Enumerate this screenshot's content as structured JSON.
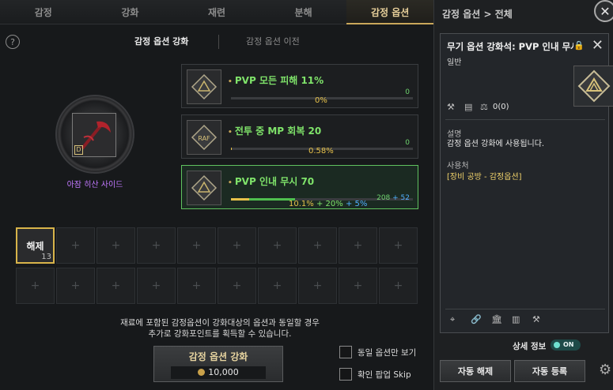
{
  "tabs": [
    "감정",
    "강화",
    "재련",
    "분해",
    "감정 옵션"
  ],
  "active_tab_index": 4,
  "help_label": "?",
  "subtabs": {
    "enhance": "감정 옵션 강화",
    "transfer": "감정 옵션 이전"
  },
  "item": {
    "name": "아잠 히산 사이드",
    "slot_badge": "D"
  },
  "options": [
    {
      "title": "PVP 모든 피해 11%",
      "percent": "0%",
      "value": "0",
      "progress": 0
    },
    {
      "title": "전투 중 MP 회복 20",
      "percent": "0.58%",
      "value": "0",
      "progress": 0.0058
    },
    {
      "title": "PVP 인내 무시 70",
      "percent": "10.1%",
      "percent_plus1": "20%",
      "percent_plus2": "5%",
      "value": "208",
      "value_plus": "52",
      "progress": 0.101,
      "progress_plus": 0.25
    }
  ],
  "materials": {
    "first_label": "해제",
    "first_count": "13",
    "empty_symbol": "+"
  },
  "description": {
    "line1": "재료에 포함된 감정옵션이 강화대상의 옵션과 동일할 경우",
    "line2": "추가로 강화포인트를 획득할 수 있습니다."
  },
  "enhance_button": {
    "label": "감정 옵션 강화",
    "cost": "10,000"
  },
  "checkboxes": {
    "same_only": "동일 옵션만 보기",
    "skip_popup": "확인 팝업 Skip"
  },
  "panel": {
    "breadcrumb": "감정 옵션 > 전체",
    "close_label": "✕",
    "tooltip": {
      "title": "무기 옵션 강화석: PVP 인내 무시",
      "grade": "일반",
      "count": "0(0)",
      "desc_label": "설명",
      "desc_text": "감정 옵션 강화에 사용됩니다.",
      "usage_label": "사용처",
      "usage_text": "[장비 공방 - 감정옵션]"
    },
    "detail_label": "상세 정보",
    "detail_toggle": "ON",
    "auto_release": "자동 해제",
    "auto_register": "자동 등록"
  },
  "colors": {
    "accent": "#c9a75a",
    "option_green": "#7fe36a",
    "selected_border": "#5fc25f",
    "item_purple": "#c178ff"
  }
}
